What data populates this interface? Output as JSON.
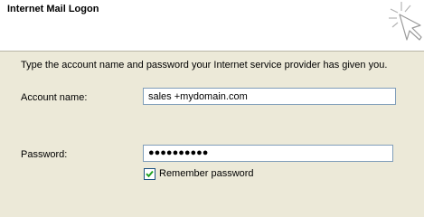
{
  "header": {
    "title": "Internet Mail Logon",
    "icon": "key-sparkle-icon"
  },
  "instructions": "Type the account name and password your Internet service provider has given you.",
  "account": {
    "label": "Account name:",
    "value": "sales +mydomain.com"
  },
  "password": {
    "label": "Password:",
    "masked": "●●●●●●●●●●"
  },
  "remember": {
    "label": "Remember password",
    "checked": true
  },
  "colors": {
    "dialog_bg": "#ece9d8",
    "header_bg": "#ffffff",
    "field_border": "#7f9db9",
    "check_green": "#21a121"
  }
}
